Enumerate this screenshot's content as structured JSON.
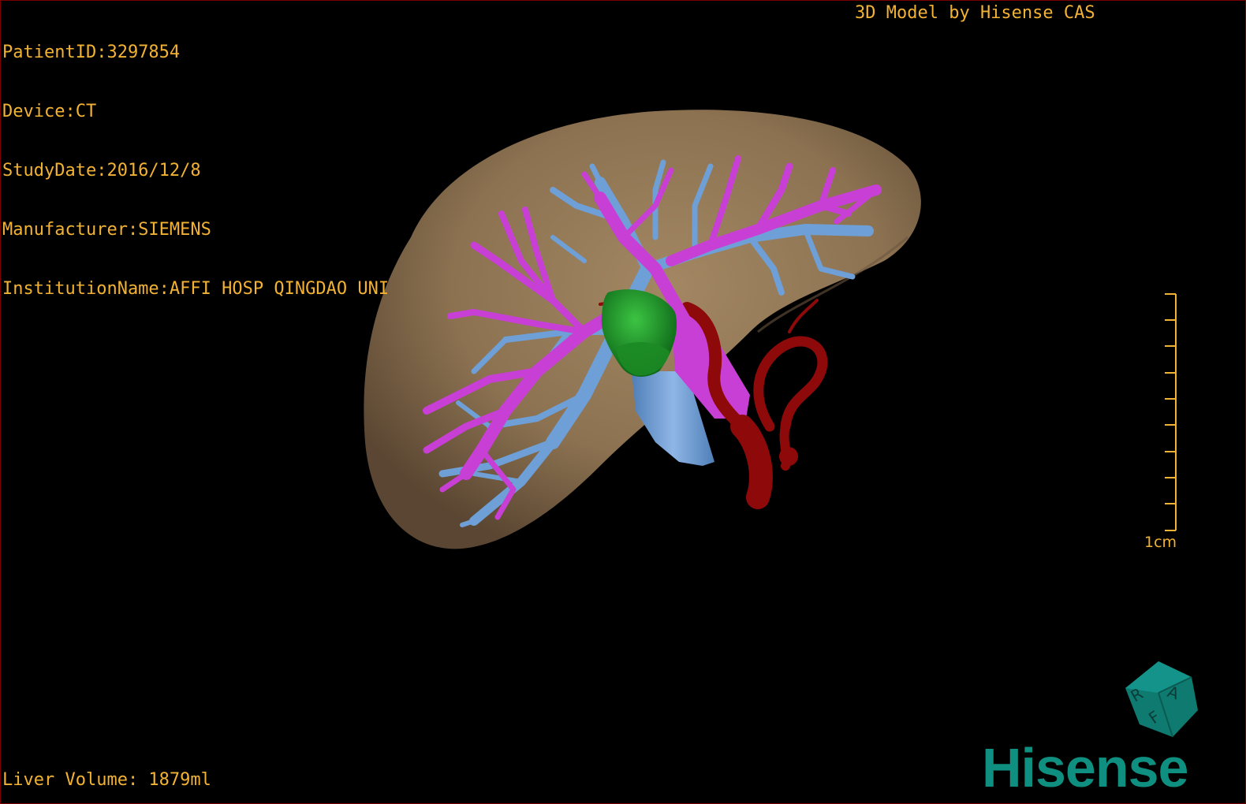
{
  "overlay": {
    "patient_id": "PatientID:3297854",
    "device": "Device:CT",
    "study_date": "StudyDate:2016/12/8",
    "manufacturer": "Manufacturer:SIEMENS",
    "institution": "InstitutionName:AFFI HOSP QINGDAO UNI",
    "model_credit": "3D Model by Hisense CAS",
    "liver_volume": "Liver Volume: 1879ml"
  },
  "scale_bar": {
    "label": "1cm"
  },
  "orientation_cube": {
    "faces": [
      "R",
      "A",
      "F"
    ]
  },
  "logo": {
    "text": "Hisense"
  },
  "colors": {
    "overlay_text": "#f2b233",
    "liver": "#8a7152",
    "portal_vein": "#c83fd6",
    "hepatic_vein": "#6e9fd6",
    "gallbladder": "#1f8e2a",
    "artery": "#8e0a0a",
    "logo": "#0e8f80"
  }
}
